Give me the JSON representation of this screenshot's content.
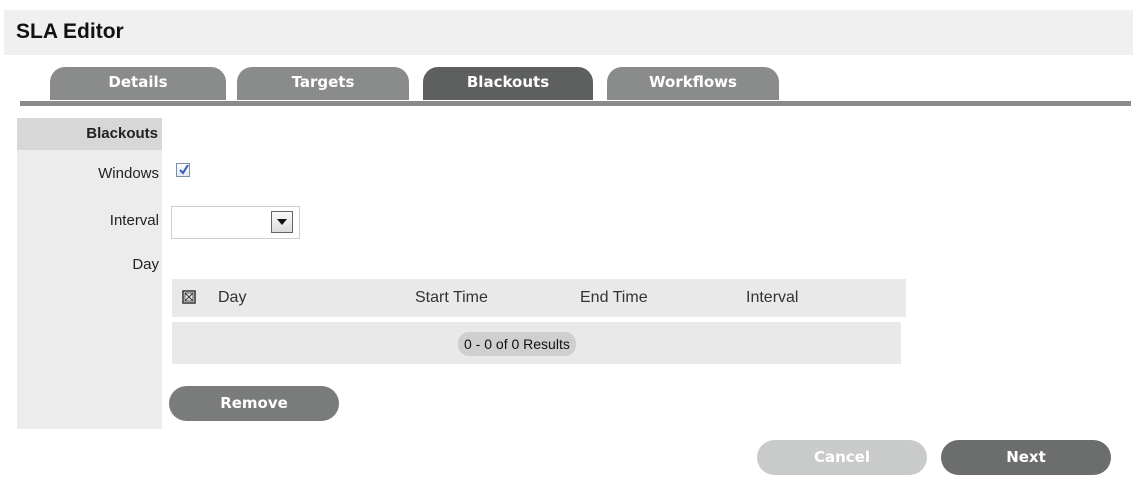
{
  "header": {
    "title": "SLA Editor"
  },
  "tabs": [
    {
      "label": "Details",
      "active": false
    },
    {
      "label": "Targets",
      "active": false
    },
    {
      "label": "Blackouts",
      "active": true
    },
    {
      "label": "Workflows",
      "active": false
    }
  ],
  "form": {
    "section_title": "Blackouts",
    "windows_label": "Windows",
    "windows_checked": true,
    "interval_label": "Interval",
    "interval_value": "",
    "day_label": "Day"
  },
  "table": {
    "columns": [
      "Day",
      "Start Time",
      "End Time",
      "Interval"
    ],
    "rows": [],
    "results_text": "0 - 0 of 0 Results"
  },
  "buttons": {
    "remove": "Remove",
    "cancel": "Cancel",
    "next": "Next"
  },
  "colors": {
    "tab_inactive": "#8a8c8c",
    "tab_active": "#5e6060",
    "button_primary": "#6c6e6e",
    "button_disabled": "#c9caca",
    "checkbox_check": "#2f5fbf"
  }
}
